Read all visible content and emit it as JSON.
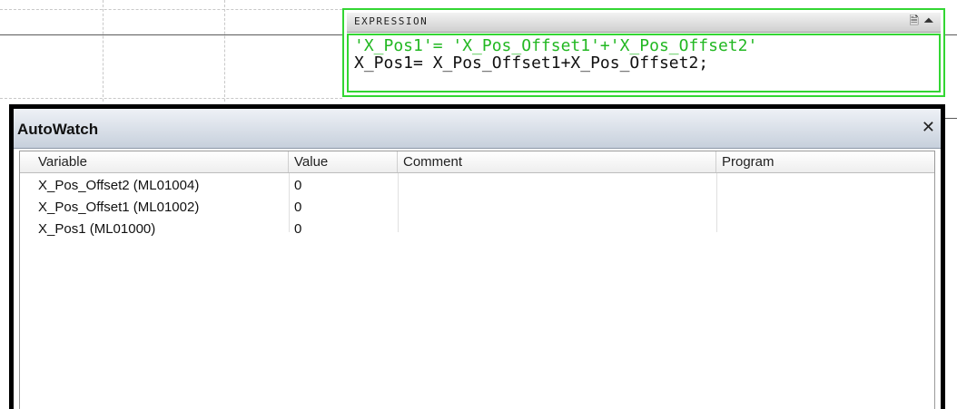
{
  "expression": {
    "title": "EXPRESSION",
    "icons": [
      "document-icon",
      "pin-icon"
    ],
    "comment_line": "'X_Pos1'= 'X_Pos_Offset1'+'X_Pos_Offset2'",
    "code_line": "X_Pos1= X_Pos_Offset1+X_Pos_Offset2;",
    "comment_color": "#22b822",
    "border_color": "#33d633"
  },
  "autowatch": {
    "title": "AutoWatch",
    "close_icon": "close-icon",
    "columns": [
      "Variable",
      "Value",
      "Comment",
      "Program"
    ],
    "rows": [
      {
        "variable": "X_Pos_Offset2 (ML01004)",
        "value": "0",
        "comment": "",
        "program": ""
      },
      {
        "variable": "X_Pos_Offset1 (ML01002)",
        "value": "0",
        "comment": "",
        "program": ""
      },
      {
        "variable": "X_Pos1 (ML01000)",
        "value": "0",
        "comment": "",
        "program": ""
      }
    ]
  }
}
